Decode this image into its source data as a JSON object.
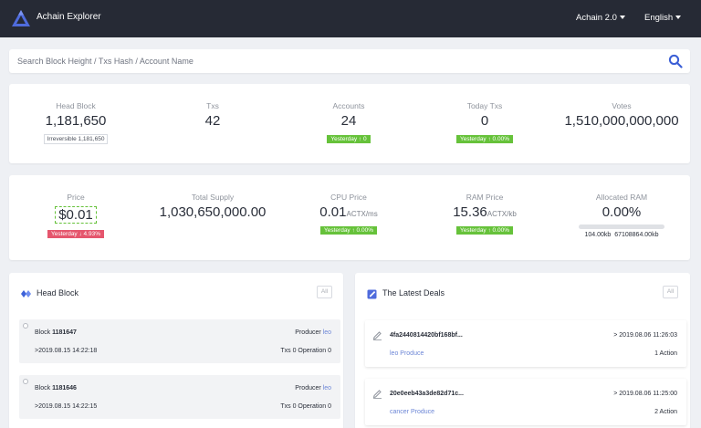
{
  "header": {
    "brand": "Achain Explorer",
    "network": "Achain 2.0",
    "language": "English"
  },
  "search": {
    "placeholder": "Search Block Height / Txs Hash / Account Name"
  },
  "stats_row1": {
    "head_block": {
      "label": "Head Block",
      "value": "1,181,650",
      "badge": "Irreversible 1,181,650"
    },
    "txs": {
      "label": "Txs",
      "value": "42"
    },
    "accounts": {
      "label": "Accounts",
      "value": "24",
      "badge": "Yesterday ↑ 0"
    },
    "today_txs": {
      "label": "Today Txs",
      "value": "0",
      "badge": "Yesterday ↑ 0.00%"
    },
    "votes": {
      "label": "Votes",
      "value": "1,510,000,000,000"
    }
  },
  "stats_row2": {
    "price": {
      "label": "Price",
      "value": "$0.01",
      "badge": "Yesterday ↓ 4.93%"
    },
    "total_supply": {
      "label": "Total Supply",
      "value": "1,030,650,000.00"
    },
    "cpu_price": {
      "label": "CPU Price",
      "value": "0.01",
      "unit": "ACTX/ms",
      "badge": "Yesterday ↑ 0.00%"
    },
    "ram_price": {
      "label": "RAM Price",
      "value": "15.36",
      "unit": "ACTX/kb",
      "badge": "Yesterday ↑ 0.00%"
    },
    "allocated_ram": {
      "label": "Allocated RAM",
      "value": "0.00%",
      "fill_fraction": 0.0,
      "used": "104.00kb",
      "total": "67108864.00kb"
    }
  },
  "head_block_panel": {
    "title": "Head Block",
    "all_label": "All",
    "blocks": [
      {
        "block_label": "Block",
        "number": "1181647",
        "producer_label": "Producer",
        "producer": "leo",
        "time": ">2019.08.15 14:22:18",
        "txs_ops": "Txs 0 Operation 0"
      },
      {
        "block_label": "Block",
        "number": "1181646",
        "producer_label": "Producer",
        "producer": "leo",
        "time": ">2019.08.15 14:22:15",
        "txs_ops": "Txs 0 Operation 0"
      }
    ]
  },
  "deals_panel": {
    "title": "The Latest Deals",
    "all_label": "All",
    "deals": [
      {
        "hash": "4fa2440814420bf168bf...",
        "time": "> 2019.08.06 11:26:03",
        "sub": "leo Produce",
        "actions": "1 Action"
      },
      {
        "hash": "20e0eeb43a3de82d71c...",
        "time": "> 2019.08.06 11:25:00",
        "sub": "cancer Produce",
        "actions": "2 Action"
      }
    ]
  },
  "colors": {
    "topbar": "#262a35",
    "accent_green": "#66c23a",
    "accent_red": "#e5566d",
    "link": "#6c86d6",
    "logo_blue": "#4f6bdc"
  }
}
